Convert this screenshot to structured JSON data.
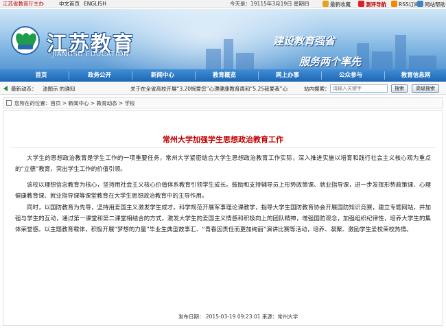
{
  "topbar": {
    "brand": "江苏省教育厅主办",
    "home": "中文首页",
    "english": "ENGLISH",
    "date": "今天是：19115年3月19日 星期四",
    "favorite": "最新收藏",
    "nav": "测评导航",
    "rss": "RSS订阅",
    "help": "网站帮助"
  },
  "banner": {
    "logo_text": "江苏教育",
    "logo_en": "JIANGSU EDUCATION",
    "slogan1": "建设教育强省",
    "slogan2": "服务两个率先"
  },
  "mainnav": {
    "items": [
      "首页",
      "政务公开",
      "新闻中心",
      "教育概览",
      "网上办事",
      "公众参与",
      "教育信息网"
    ]
  },
  "newsbar": {
    "label": "最新动态：",
    "notice": "油图示 的通知",
    "scroll": "关于在全省高校开展“3.20悯爱您”心理健康教育周和“5.25我爱我”心理",
    "search_label": "站内搜索：",
    "search_placeholder": "请输入关键字",
    "search_btn": "搜索",
    "adv_btn": "高级搜索"
  },
  "breadcrumb": {
    "path": "您所在的位置：首页 > 新闻中心 > 教育动态 > 学校"
  },
  "article": {
    "title": "常州大学加强学生思想政治教育工作",
    "paragraphs": [
      "大学生的思想政治教育是学生工作的一项重要任务，常州大学紧密结合大学生思想政治教育工作实际，深入推进实施以培育和践行社会主义核心观为重点的“立德”教育，突出学生工作的价值引领。",
      "该校以理想信念教育为核心，坚持用社会主义核心价值体系教育引领学生成长。鼓励和支持辅导员上形势政策课、就业指导课，进一步发挥形势政策课、心理健康教育课、就业指导课等课堂教育在大学生思想政治教育中的主导作用。",
      "同时，以国防教育为先导，坚持用爱国主义激发学生成才。科学规范开展军事理论课教学，指导大学生国防教育协会开展国防知识竞赛，建立专题网站，并加强与学生的互动，通过第一课堂和第二课堂相结合的方式，激发大学生的爱国主义情感和积极向上的团队精神，增强国防观念，加强组织纪律性，培养大学生的集体荣誉感。以主题教育载体，积极开展“梦想的力量”毕业生典型故事汇、“青春因责任而更加绚丽”演讲比赛等活动，培养、凝聚、激励学生爱校荣校热情。"
    ],
    "meta": "发布日期： 2015-03-19 09:23:01     来源：常州大学"
  },
  "colors": {
    "brand_red": "#c00000",
    "nav_blue": "#1f67b3",
    "title_red": "#c00000"
  }
}
